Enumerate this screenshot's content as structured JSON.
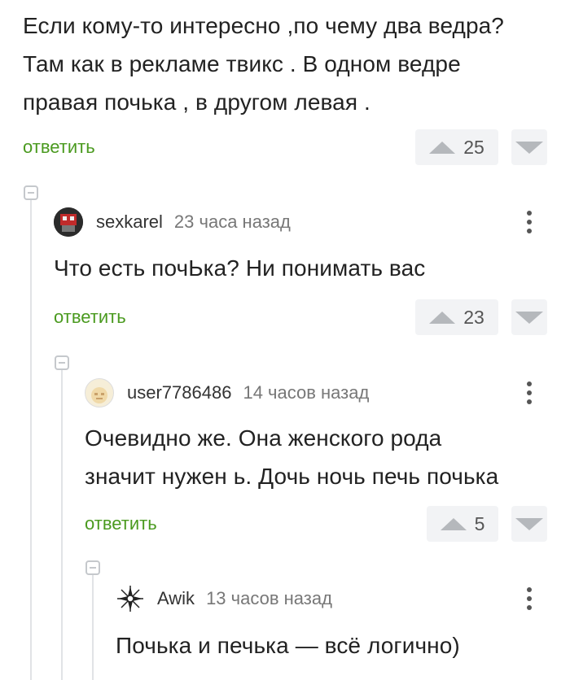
{
  "comments": [
    {
      "text_lines": [
        "Если кому-то интересно ,по чему два ведра?",
        "Там как в рекламе твикс . В одном ведре",
        "правая почька , в другом левая ."
      ],
      "reply_label": "ответить",
      "votes": "25"
    },
    {
      "username": "sexkarel",
      "time": "23 часа назад",
      "text_lines": [
        "Что есть почЬка? Ни понимать вас"
      ],
      "reply_label": "ответить",
      "votes": "23"
    },
    {
      "username": "user7786486",
      "time": "14 часов назад",
      "text_lines": [
        "Очевидно же. Она женского рода",
        "значит нужен ь. Дочь ночь печь почька"
      ],
      "reply_label": "ответить",
      "votes": "5"
    },
    {
      "username": "Awik",
      "time": "13 часов назад",
      "text_lines": [
        "Почька и печька — всё логично)"
      ]
    }
  ],
  "colors": {
    "reply_link": "#4a9a1f",
    "vote_bg": "#f2f3f5",
    "arrow": "#b5b8bc",
    "thread_line": "#e1e3e6"
  },
  "icons": [
    "vote-up-icon",
    "vote-down-icon",
    "collapse-icon",
    "more-icon",
    "avatar"
  ]
}
